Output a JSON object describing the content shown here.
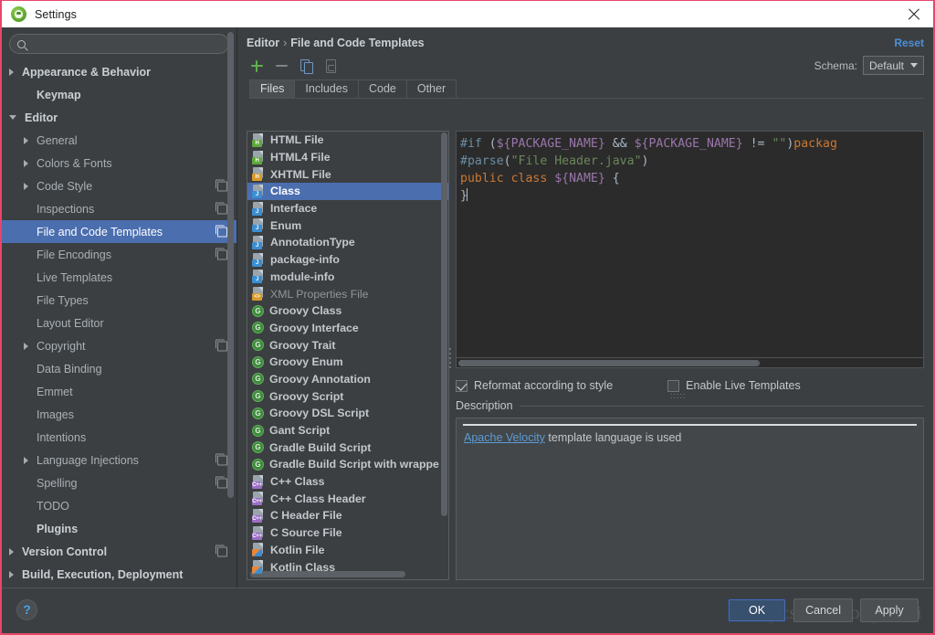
{
  "window": {
    "title": "Settings",
    "app_icon": "android-studio-icon",
    "close_icon": "close-icon"
  },
  "search": {
    "value": "",
    "placeholder": "",
    "icon": "search-icon"
  },
  "sidebar": {
    "items": [
      {
        "label": "Appearance & Behavior",
        "indent": 0,
        "arrow": "right",
        "bold": true,
        "config": false
      },
      {
        "label": "Keymap",
        "indent": 1,
        "arrow": "none",
        "bold": true,
        "config": false
      },
      {
        "label": "Editor",
        "indent": 0,
        "arrow": "down",
        "bold": true,
        "config": false
      },
      {
        "label": "General",
        "indent": 1,
        "arrow": "right",
        "bold": false,
        "config": false
      },
      {
        "label": "Colors & Fonts",
        "indent": 1,
        "arrow": "right",
        "bold": false,
        "config": false
      },
      {
        "label": "Code Style",
        "indent": 1,
        "arrow": "right",
        "bold": false,
        "config": true
      },
      {
        "label": "Inspections",
        "indent": 1,
        "arrow": "none",
        "bold": false,
        "config": true
      },
      {
        "label": "File and Code Templates",
        "indent": 1,
        "arrow": "none",
        "bold": false,
        "config": true,
        "selected": true
      },
      {
        "label": "File Encodings",
        "indent": 1,
        "arrow": "none",
        "bold": false,
        "config": true
      },
      {
        "label": "Live Templates",
        "indent": 1,
        "arrow": "none",
        "bold": false,
        "config": false
      },
      {
        "label": "File Types",
        "indent": 1,
        "arrow": "none",
        "bold": false,
        "config": false
      },
      {
        "label": "Layout Editor",
        "indent": 1,
        "arrow": "none",
        "bold": false,
        "config": false
      },
      {
        "label": "Copyright",
        "indent": 1,
        "arrow": "right",
        "bold": false,
        "config": true
      },
      {
        "label": "Data Binding",
        "indent": 1,
        "arrow": "none",
        "bold": false,
        "config": false
      },
      {
        "label": "Emmet",
        "indent": 1,
        "arrow": "none",
        "bold": false,
        "config": false
      },
      {
        "label": "Images",
        "indent": 1,
        "arrow": "none",
        "bold": false,
        "config": false
      },
      {
        "label": "Intentions",
        "indent": 1,
        "arrow": "none",
        "bold": false,
        "config": false
      },
      {
        "label": "Language Injections",
        "indent": 1,
        "arrow": "right",
        "bold": false,
        "config": true
      },
      {
        "label": "Spelling",
        "indent": 1,
        "arrow": "none",
        "bold": false,
        "config": true
      },
      {
        "label": "TODO",
        "indent": 1,
        "arrow": "none",
        "bold": false,
        "config": false
      },
      {
        "label": "Plugins",
        "indent": 1,
        "arrow": "none",
        "bold": true,
        "config": false
      },
      {
        "label": "Version Control",
        "indent": 0,
        "arrow": "right",
        "bold": true,
        "config": true
      },
      {
        "label": "Build, Execution, Deployment",
        "indent": 0,
        "arrow": "right",
        "bold": true,
        "config": false
      }
    ]
  },
  "breadcrumb": {
    "parent": "Editor",
    "separator": "›",
    "current": "File and Code Templates"
  },
  "reset_link": "Reset",
  "toolbar": {
    "add_icon": "plus-icon",
    "remove_icon": "minus-icon",
    "copy_icon": "copy-icon",
    "reset_template_icon": "reset-template-icon"
  },
  "schema": {
    "label": "Schema:",
    "value": "Default",
    "caret_icon": "chevron-down-icon"
  },
  "tabs": [
    {
      "label": "Files",
      "active": true
    },
    {
      "label": "Includes",
      "active": false
    },
    {
      "label": "Code",
      "active": false
    },
    {
      "label": "Other",
      "active": false
    }
  ],
  "templates": [
    {
      "label": "HTML File",
      "icon": "html-file-icon",
      "kind": "doc",
      "badge": "H",
      "badge_class": "b-html",
      "selected": false,
      "dim": false
    },
    {
      "label": "HTML4 File",
      "icon": "html4-file-icon",
      "kind": "doc",
      "badge": "H",
      "badge_class": "b-html",
      "selected": false,
      "dim": false
    },
    {
      "label": "XHTML File",
      "icon": "xhtml-file-icon",
      "kind": "doc",
      "badge": "H",
      "badge_class": "b-xhtml",
      "selected": false,
      "dim": false
    },
    {
      "label": "Class",
      "icon": "java-class-icon",
      "kind": "doc",
      "badge": "J",
      "badge_class": "b-java",
      "selected": true,
      "dim": false
    },
    {
      "label": "Interface",
      "icon": "java-interface-icon",
      "kind": "doc",
      "badge": "J",
      "badge_class": "b-java",
      "selected": false,
      "dim": false
    },
    {
      "label": "Enum",
      "icon": "java-enum-icon",
      "kind": "doc",
      "badge": "J",
      "badge_class": "b-java",
      "selected": false,
      "dim": false
    },
    {
      "label": "AnnotationType",
      "icon": "java-annotation-icon",
      "kind": "doc",
      "badge": "J",
      "badge_class": "b-java",
      "selected": false,
      "dim": false
    },
    {
      "label": "package-info",
      "icon": "java-package-info-icon",
      "kind": "doc",
      "badge": "J",
      "badge_class": "b-java",
      "selected": false,
      "dim": false
    },
    {
      "label": "module-info",
      "icon": "java-module-info-icon",
      "kind": "doc",
      "badge": "J",
      "badge_class": "b-java",
      "selected": false,
      "dim": false
    },
    {
      "label": "XML Properties File",
      "icon": "xml-properties-icon",
      "kind": "doc",
      "badge": "<>",
      "badge_class": "b-xml",
      "selected": false,
      "dim": true
    },
    {
      "label": "Groovy Class",
      "icon": "groovy-class-icon",
      "kind": "groovy",
      "badge": "G",
      "badge_class": "",
      "selected": false,
      "dim": false
    },
    {
      "label": "Groovy Interface",
      "icon": "groovy-interface-icon",
      "kind": "groovy",
      "badge": "G",
      "badge_class": "",
      "selected": false,
      "dim": false
    },
    {
      "label": "Groovy Trait",
      "icon": "groovy-trait-icon",
      "kind": "groovy",
      "badge": "G",
      "badge_class": "",
      "selected": false,
      "dim": false
    },
    {
      "label": "Groovy Enum",
      "icon": "groovy-enum-icon",
      "kind": "groovy",
      "badge": "G",
      "badge_class": "",
      "selected": false,
      "dim": false
    },
    {
      "label": "Groovy Annotation",
      "icon": "groovy-annotation-icon",
      "kind": "groovy",
      "badge": "G",
      "badge_class": "",
      "selected": false,
      "dim": false
    },
    {
      "label": "Groovy Script",
      "icon": "groovy-script-icon",
      "kind": "groovy",
      "badge": "G",
      "badge_class": "",
      "selected": false,
      "dim": false
    },
    {
      "label": "Groovy DSL Script",
      "icon": "groovy-dsl-icon",
      "kind": "groovy",
      "badge": "G",
      "badge_class": "",
      "selected": false,
      "dim": false
    },
    {
      "label": "Gant Script",
      "icon": "gant-script-icon",
      "kind": "groovy",
      "badge": "G",
      "badge_class": "",
      "selected": false,
      "dim": false
    },
    {
      "label": "Gradle Build Script",
      "icon": "gradle-build-icon",
      "kind": "groovy",
      "badge": "G",
      "badge_class": "",
      "selected": false,
      "dim": false
    },
    {
      "label": "Gradle Build Script with wrappe",
      "icon": "gradle-wrapper-icon",
      "kind": "groovy",
      "badge": "G",
      "badge_class": "",
      "selected": false,
      "dim": false
    },
    {
      "label": "C++ Class",
      "icon": "cpp-class-icon",
      "kind": "doc",
      "badge": "C++",
      "badge_class": "b-cpp",
      "selected": false,
      "dim": false
    },
    {
      "label": "C++ Class Header",
      "icon": "cpp-header-icon",
      "kind": "doc",
      "badge": "C++",
      "badge_class": "b-cpp",
      "selected": false,
      "dim": false
    },
    {
      "label": "C Header File",
      "icon": "c-header-icon",
      "kind": "doc",
      "badge": "C++",
      "badge_class": "b-cpp",
      "selected": false,
      "dim": false
    },
    {
      "label": "C Source File",
      "icon": "c-source-icon",
      "kind": "doc",
      "badge": "C++",
      "badge_class": "b-cpp",
      "selected": false,
      "dim": false
    },
    {
      "label": "Kotlin File",
      "icon": "kotlin-file-icon",
      "kind": "doc",
      "badge": "",
      "badge_class": "b-kt",
      "selected": false,
      "dim": false
    },
    {
      "label": "Kotlin Class",
      "icon": "kotlin-class-icon",
      "kind": "doc",
      "badge": "",
      "badge_class": "b-kt",
      "selected": false,
      "dim": false
    }
  ],
  "editor": {
    "lines": [
      [
        {
          "t": "#if ",
          "c": "k-dir"
        },
        {
          "t": "(",
          "c": "k-op"
        },
        {
          "t": "${PACKAGE_NAME}",
          "c": "k-var"
        },
        {
          "t": " && ",
          "c": "k-op"
        },
        {
          "t": "${PACKAGE_NAME}",
          "c": "k-var"
        },
        {
          "t": " != ",
          "c": "k-op"
        },
        {
          "t": "\"\"",
          "c": "k-str"
        },
        {
          "t": ")",
          "c": "k-op"
        },
        {
          "t": "packag",
          "c": "k-kw"
        }
      ],
      [
        {
          "t": "#parse",
          "c": "k-dir"
        },
        {
          "t": "(",
          "c": "k-op"
        },
        {
          "t": "\"File Header.java\"",
          "c": "k-str"
        },
        {
          "t": ")",
          "c": "k-op"
        }
      ],
      [
        {
          "t": "public class ",
          "c": "k-kw"
        },
        {
          "t": "${NAME}",
          "c": "k-var"
        },
        {
          "t": " {",
          "c": "k-op"
        }
      ],
      [
        {
          "t": "}",
          "c": "k-op"
        }
      ]
    ]
  },
  "options": {
    "reformat": {
      "label": "Reformat according to style",
      "underline_char": "R",
      "checked": true
    },
    "live_templates": {
      "label": "Enable Live Templates",
      "underline_char": "L",
      "checked": false
    }
  },
  "description": {
    "label": "Description",
    "link_text": "Apache Velocity",
    "rest_text": " template language is used"
  },
  "footer": {
    "help_icon": "help-icon",
    "help_glyph": "?",
    "watermark": "//blog.csdn.net/oxgenhui",
    "buttons": [
      {
        "label": "OK",
        "primary": true
      },
      {
        "label": "Cancel",
        "primary": false
      },
      {
        "label": "Apply",
        "primary": false
      }
    ]
  },
  "colors": {
    "selection_blue": "#4b6eaf",
    "link_blue": "#4a90d9",
    "panel_bg": "#3c3f41",
    "editor_bg": "#2b2b2b",
    "accent_green": "#5faf4e",
    "border_pink": "#e8456b"
  }
}
